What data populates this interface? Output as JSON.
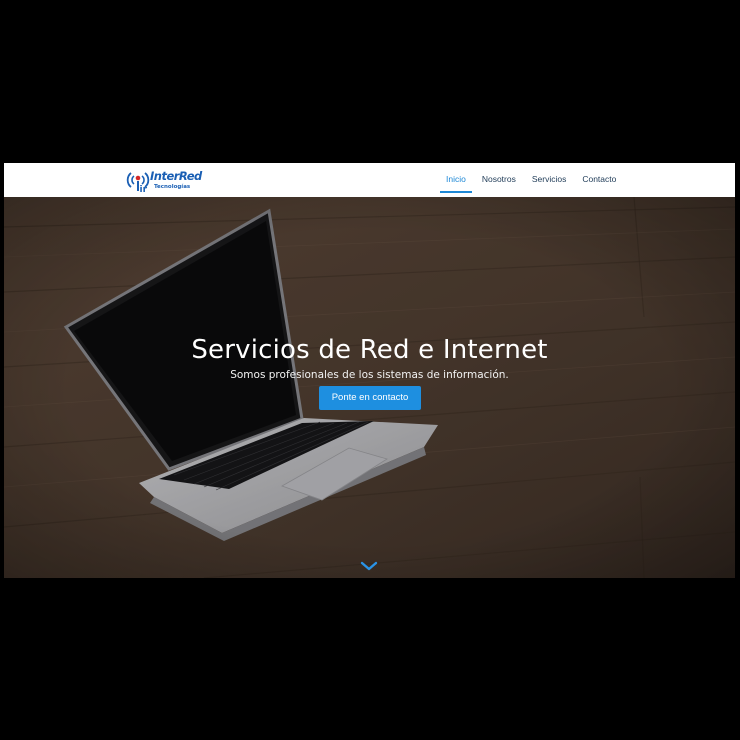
{
  "header": {
    "logo": {
      "name": "InterRed",
      "tagline": "Tecnologías",
      "mark_letters": "ir",
      "color": "#1a5fb4"
    },
    "nav": [
      {
        "label": "Inicio",
        "active": true
      },
      {
        "label": "Nosotros",
        "active": false
      },
      {
        "label": "Servicios",
        "active": false
      },
      {
        "label": "Contacto",
        "active": false
      }
    ],
    "active_color": "#1e88d6"
  },
  "hero": {
    "title": "Servicios de Red e Internet",
    "subtitle": "Somos profesionales de los sistemas de información.",
    "cta_label": "Ponte en contacto",
    "cta_color": "#1e8fe0",
    "background": "laptop on wooden desk photo",
    "scroll_icon": "chevron-down-icon"
  }
}
